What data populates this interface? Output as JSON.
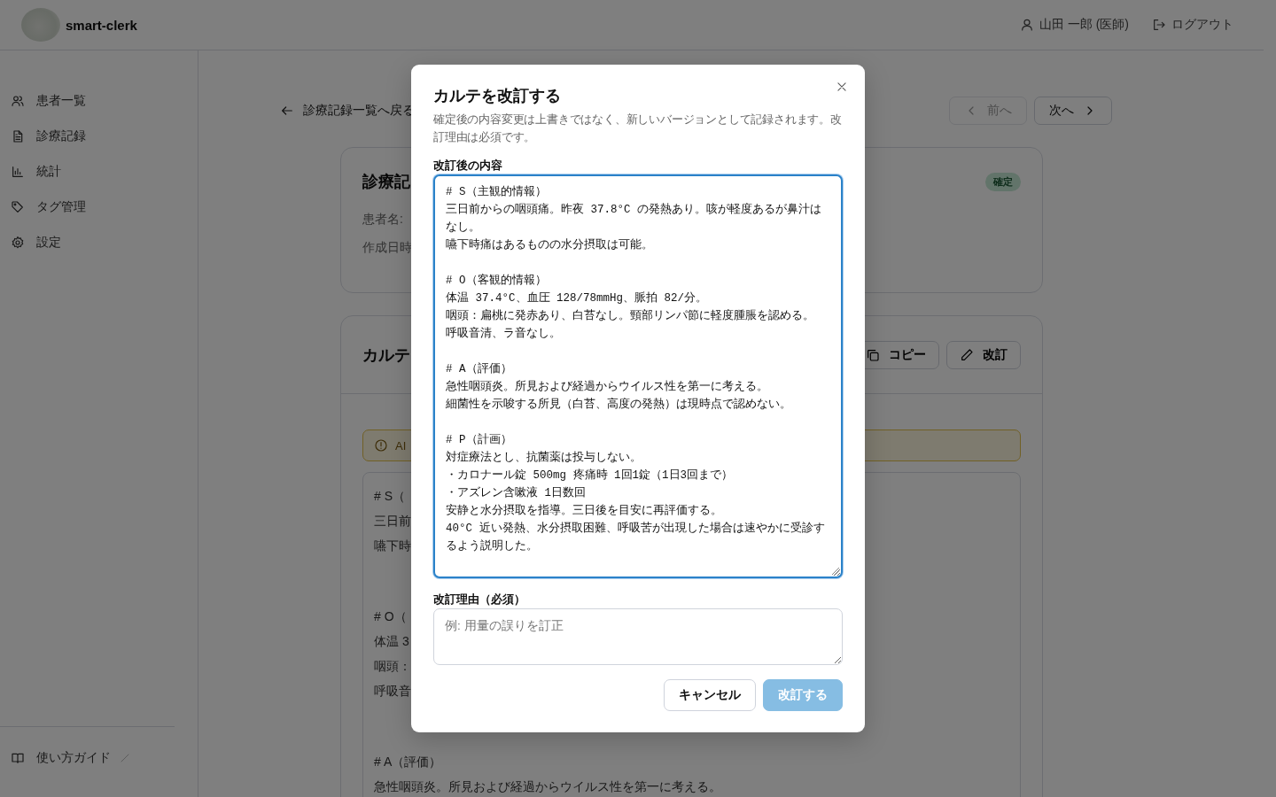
{
  "header": {
    "app_name": "smart-clerk",
    "user": "山田 一郎 (医師)",
    "logout": "ログアウト"
  },
  "sidebar": {
    "items": [
      {
        "label": "患者一覧",
        "kind": "users"
      },
      {
        "label": "診療記録",
        "kind": "file"
      },
      {
        "label": "統計",
        "kind": "chart"
      },
      {
        "label": "タグ管理",
        "kind": "tag"
      },
      {
        "label": "設定",
        "kind": "gear"
      }
    ],
    "guide": "使い方ガイド"
  },
  "back_link": "診療記録一覧へ戻る",
  "pager": [
    {
      "label": "前へ",
      "kind": "prev",
      "disabled": true
    },
    {
      "label": "次へ",
      "kind": "next",
      "disabled": false
    }
  ],
  "record_card": {
    "title": "診療記",
    "status": "確定",
    "fields": [
      "患者名:",
      "作成日時"
    ]
  },
  "content_card": {
    "title": "カルテ",
    "actions": [
      {
        "label": "コピー",
        "kind": "copy"
      },
      {
        "label": "改訂",
        "kind": "edit"
      }
    ],
    "notice": "AI",
    "sections": [
      [
        "# S（",
        "三日前",
        "嚥下時"
      ],
      [
        "# O（",
        "体温 3",
        "咽頭：",
        "呼吸音"
      ],
      [
        "# A（評価）",
        "急性咽頭炎。所見および経過からウイルス性を第一に考える。"
      ]
    ]
  },
  "modal": {
    "title": "カルテを改訂する",
    "description": "確定後の内容変更は上書きではなく、新しいバージョンとして記録されます。改訂理由は必須です。",
    "content_label": "改訂後の内容",
    "content_sections": [
      [
        "# S（主観的情報）",
        "三日前からの咽頭痛。昨夜 37.8°C の発熱あり。咳が軽度あるが鼻汁はなし。",
        "嚥下時痛はあるものの水分摂取は可能。"
      ],
      [
        "# O（客観的情報）",
        "体温 37.4°C、血圧 128/78mmHg、脈拍 82/分。",
        "咽頭：扁桃に発赤あり、白苔なし。頸部リンパ節に軽度腫脹を認める。",
        "呼吸音清、ラ音なし。"
      ],
      [
        "# A（評価）",
        "急性咽頭炎。所見および経過からウイルス性を第一に考える。",
        "細菌性を示唆する所見（白苔、高度の発熱）は現時点で認めない。"
      ],
      [
        "# P（計画）",
        "対症療法とし、抗菌薬は投与しない。",
        "・カロナール錠 500mg 疼痛時 1回1錠（1日3回まで）",
        "・アズレン含嗽液 1日数回",
        "安静と水分摂取を指導。三日後を目安に再評価する。",
        "40°C 近い発熱、水分摂取困難、呼吸苦が出現した場合は速やかに受診するよう説明した。"
      ]
    ],
    "reason_label": "改訂理由（必須）",
    "reason_placeholder": "例: 用量の誤りを訂正",
    "buttons": [
      {
        "label": "キャンセル",
        "kind": "secondary",
        "disabled": false
      },
      {
        "label": "改訂する",
        "kind": "primary",
        "disabled": true
      }
    ]
  }
}
